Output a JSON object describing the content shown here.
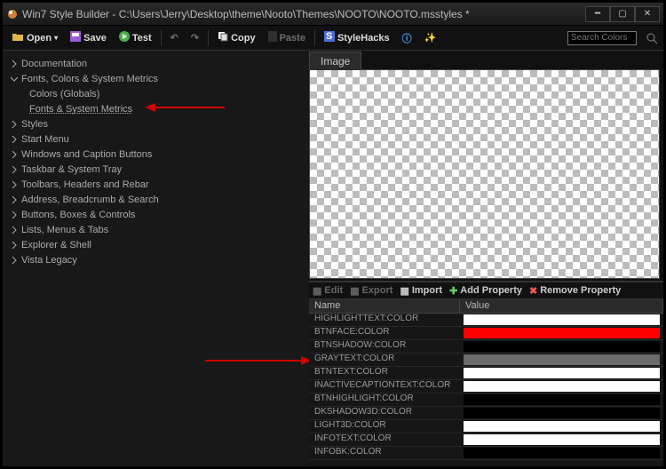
{
  "window": {
    "title": "Win7 Style Builder - C:\\Users\\Jerry\\Desktop\\theme\\Nooto\\Themes\\NOOTO\\NOOTO.msstyles *"
  },
  "toolbar": {
    "open": "Open",
    "save": "Save",
    "test": "Test",
    "copy": "Copy",
    "paste": "Paste",
    "stylehacks": "StyleHacks",
    "search_placeholder": "Search Colors"
  },
  "tree": [
    {
      "label": "Documentation",
      "expandable": true,
      "expanded": false
    },
    {
      "label": "Fonts, Colors & System Metrics",
      "expandable": true,
      "expanded": true
    },
    {
      "label": "Colors (Globals)",
      "child": true
    },
    {
      "label": "Fonts & System Metrics",
      "child": true,
      "selected": true
    },
    {
      "label": "Styles",
      "expandable": true,
      "expanded": false
    },
    {
      "label": "Start Menu",
      "expandable": true,
      "expanded": false
    },
    {
      "label": "Windows and Caption Buttons",
      "expandable": true,
      "expanded": false
    },
    {
      "label": "Taskbar & System Tray",
      "expandable": true,
      "expanded": false
    },
    {
      "label": "Toolbars, Headers and Rebar",
      "expandable": true,
      "expanded": false
    },
    {
      "label": "Address, Breadcrumb & Search",
      "expandable": true,
      "expanded": false
    },
    {
      "label": "Buttons, Boxes & Controls",
      "expandable": true,
      "expanded": false
    },
    {
      "label": "Lists, Menus & Tabs",
      "expandable": true,
      "expanded": false
    },
    {
      "label": "Explorer & Shell",
      "expandable": true,
      "expanded": false
    },
    {
      "label": "Vista Legacy",
      "expandable": true,
      "expanded": false
    }
  ],
  "image_panel": {
    "tab": "Image"
  },
  "prop_toolbar": {
    "edit": "Edit",
    "export": "Export",
    "import": "Import",
    "add": "Add Property",
    "remove": "Remove Property"
  },
  "grid": {
    "col_name": "Name",
    "col_value": "Value",
    "rows": [
      {
        "name": "HIGHLIGHTTEXT:COLOR",
        "color": "#ffffff"
      },
      {
        "name": "BTNFACE:COLOR",
        "color": "#ff0000"
      },
      {
        "name": "BTNSHADOW:COLOR",
        "color": "#000000"
      },
      {
        "name": "GRAYTEXT:COLOR",
        "color": "#6b6b6b"
      },
      {
        "name": "BTNTEXT:COLOR",
        "color": "#ffffff"
      },
      {
        "name": "INACTIVECAPTIONTEXT:COLOR",
        "color": "#ffffff"
      },
      {
        "name": "BTNHIGHLIGHT:COLOR",
        "color": "#000000"
      },
      {
        "name": "DKSHADOW3D:COLOR",
        "color": "#000000"
      },
      {
        "name": "LIGHT3D:COLOR",
        "color": "#ffffff"
      },
      {
        "name": "INFOTEXT:COLOR",
        "color": "#ffffff"
      },
      {
        "name": "INFOBK:COLOR",
        "color": "#000000"
      }
    ]
  }
}
